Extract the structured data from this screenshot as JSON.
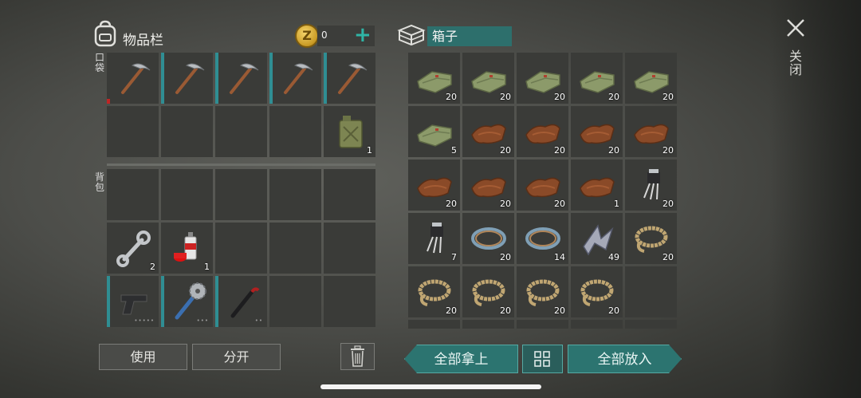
{
  "inventory": {
    "title": "物品栏",
    "coins": "0",
    "coin_symbol": "Z",
    "add_label": "+",
    "pocket_label": "口袋",
    "backpack_label": "背包",
    "pocket_slots": [
      {
        "icon": "pickaxe-icon",
        "count": "",
        "bar": "red"
      },
      {
        "icon": "pickaxe-icon",
        "count": "",
        "bar": "teal"
      },
      {
        "icon": "pickaxe-icon",
        "count": "",
        "bar": "teal"
      },
      {
        "icon": "pickaxe-icon",
        "count": "",
        "bar": "teal"
      },
      {
        "icon": "pickaxe-icon",
        "count": "",
        "bar": "teal"
      },
      {
        "icon": "",
        "count": ""
      },
      {
        "icon": "",
        "count": ""
      },
      {
        "icon": "",
        "count": ""
      },
      {
        "icon": "",
        "count": ""
      },
      {
        "icon": "jerrycan-icon",
        "count": "1"
      }
    ],
    "backpack_slots": [
      {
        "icon": "",
        "count": ""
      },
      {
        "icon": "",
        "count": ""
      },
      {
        "icon": "",
        "count": ""
      },
      {
        "icon": "",
        "count": ""
      },
      {
        "icon": "",
        "count": ""
      },
      {
        "icon": "wrench-icon",
        "count": "2"
      },
      {
        "icon": "spray-can-icon",
        "count": "1"
      },
      {
        "icon": "",
        "count": ""
      },
      {
        "icon": "",
        "count": ""
      },
      {
        "icon": "",
        "count": ""
      },
      {
        "icon": "pistol-icon",
        "count": "",
        "bar": "teal",
        "dots": "•••••"
      },
      {
        "icon": "saw-club-icon",
        "count": "",
        "bar": "teal",
        "dots": "•••"
      },
      {
        "icon": "crowbar-icon",
        "count": "",
        "bar": "teal",
        "dots": "••"
      },
      {
        "icon": "",
        "count": ""
      },
      {
        "icon": "",
        "count": ""
      }
    ],
    "use_label": "使用",
    "split_label": "分开"
  },
  "box": {
    "title": "箱子",
    "slots": [
      {
        "icon": "cloth-icon",
        "count": "20"
      },
      {
        "icon": "cloth-icon",
        "count": "20"
      },
      {
        "icon": "cloth-icon",
        "count": "20"
      },
      {
        "icon": "cloth-icon",
        "count": "20"
      },
      {
        "icon": "cloth-icon",
        "count": "20"
      },
      {
        "icon": "cloth-icon",
        "count": "5"
      },
      {
        "icon": "leather-icon",
        "count": "20"
      },
      {
        "icon": "leather-icon",
        "count": "20"
      },
      {
        "icon": "leather-icon",
        "count": "20"
      },
      {
        "icon": "leather-icon",
        "count": "20"
      },
      {
        "icon": "leather-icon",
        "count": "20"
      },
      {
        "icon": "leather-icon",
        "count": "20"
      },
      {
        "icon": "leather-icon",
        "count": "20"
      },
      {
        "icon": "leather-icon",
        "count": "1"
      },
      {
        "icon": "transistor-icon",
        "count": "20"
      },
      {
        "icon": "transistor-icon",
        "count": "7"
      },
      {
        "icon": "wire-icon",
        "count": "20"
      },
      {
        "icon": "wire-icon",
        "count": "14"
      },
      {
        "icon": "scrap-metal-icon",
        "count": "49"
      },
      {
        "icon": "rope-icon",
        "count": "20"
      },
      {
        "icon": "rope-icon",
        "count": "20"
      },
      {
        "icon": "rope-icon",
        "count": "20"
      },
      {
        "icon": "rope-icon",
        "count": "20"
      },
      {
        "icon": "rope-icon",
        "count": "20"
      },
      {
        "icon": "",
        "count": ""
      },
      {
        "icon": "",
        "count": ""
      },
      {
        "icon": "",
        "count": ""
      },
      {
        "icon": "",
        "count": ""
      },
      {
        "icon": "",
        "count": ""
      },
      {
        "icon": "",
        "count": ""
      }
    ],
    "take_all_label": "全部拿上",
    "put_all_label": "全部放入"
  },
  "close_label": "关闭",
  "colors": {
    "accent": "#2c7470",
    "durability": "#2f8e93",
    "coin": "#d9ac33"
  }
}
